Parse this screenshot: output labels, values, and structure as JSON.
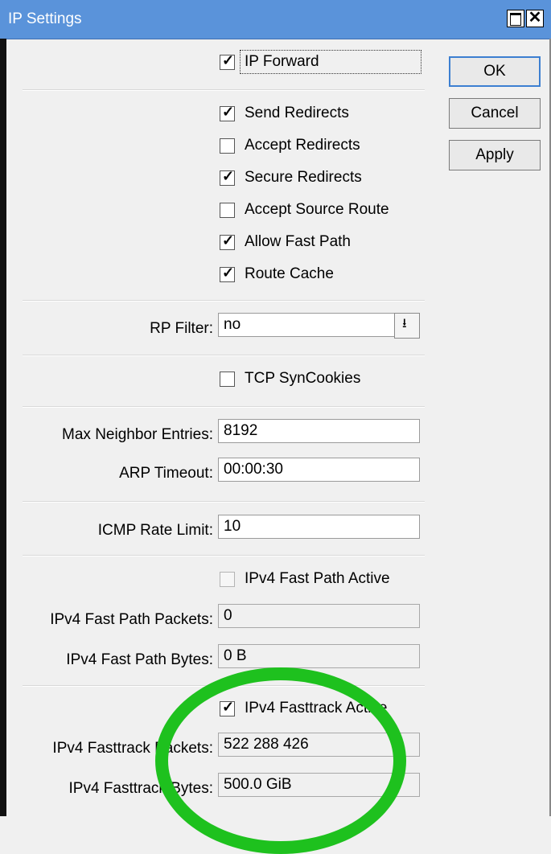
{
  "window": {
    "title": "IP Settings"
  },
  "buttons": {
    "ok": "OK",
    "cancel": "Cancel",
    "apply": "Apply"
  },
  "checkboxes": {
    "ip_forward": {
      "label": "IP Forward",
      "checked": true
    },
    "send_redirects": {
      "label": "Send Redirects",
      "checked": true
    },
    "accept_redirects": {
      "label": "Accept Redirects",
      "checked": false
    },
    "secure_redirects": {
      "label": "Secure Redirects",
      "checked": true
    },
    "accept_source_route": {
      "label": "Accept Source Route",
      "checked": false
    },
    "allow_fast_path": {
      "label": "Allow Fast Path",
      "checked": true
    },
    "route_cache": {
      "label": "Route Cache",
      "checked": true
    },
    "tcp_syncookies": {
      "label": "TCP SynCookies",
      "checked": false
    },
    "ipv4_fast_path_active": {
      "label": "IPv4 Fast Path Active",
      "checked": false
    },
    "ipv4_fasttrack_active": {
      "label": "IPv4 Fasttrack Active",
      "checked": true
    }
  },
  "fields": {
    "rp_filter": {
      "label": "RP Filter:",
      "value": "no"
    },
    "max_neighbor_entries": {
      "label": "Max Neighbor Entries:",
      "value": "8192"
    },
    "arp_timeout": {
      "label": "ARP Timeout:",
      "value": "00:00:30"
    },
    "icmp_rate_limit": {
      "label": "ICMP Rate Limit:",
      "value": "10"
    },
    "ipv4_fast_path_packets": {
      "label": "IPv4 Fast Path Packets:",
      "value": "0"
    },
    "ipv4_fast_path_bytes": {
      "label": "IPv4 Fast Path Bytes:",
      "value": "0 B"
    },
    "ipv4_fasttrack_packets": {
      "label": "IPv4 Fasttrack Packets:",
      "value": "522 288 426"
    },
    "ipv4_fasttrack_bytes": {
      "label": "IPv4 Fasttrack Bytes:",
      "value": "500.0 GiB"
    }
  },
  "icons": {
    "maximize": "maximize-icon",
    "close": "close-icon",
    "dropdown": "dropdown-arrow-icon",
    "check": "checkmark-icon"
  },
  "colors": {
    "titlebar": "#5a93da",
    "annotation_circle": "#1ec11e",
    "default_button_border": "#3c7fd1"
  }
}
